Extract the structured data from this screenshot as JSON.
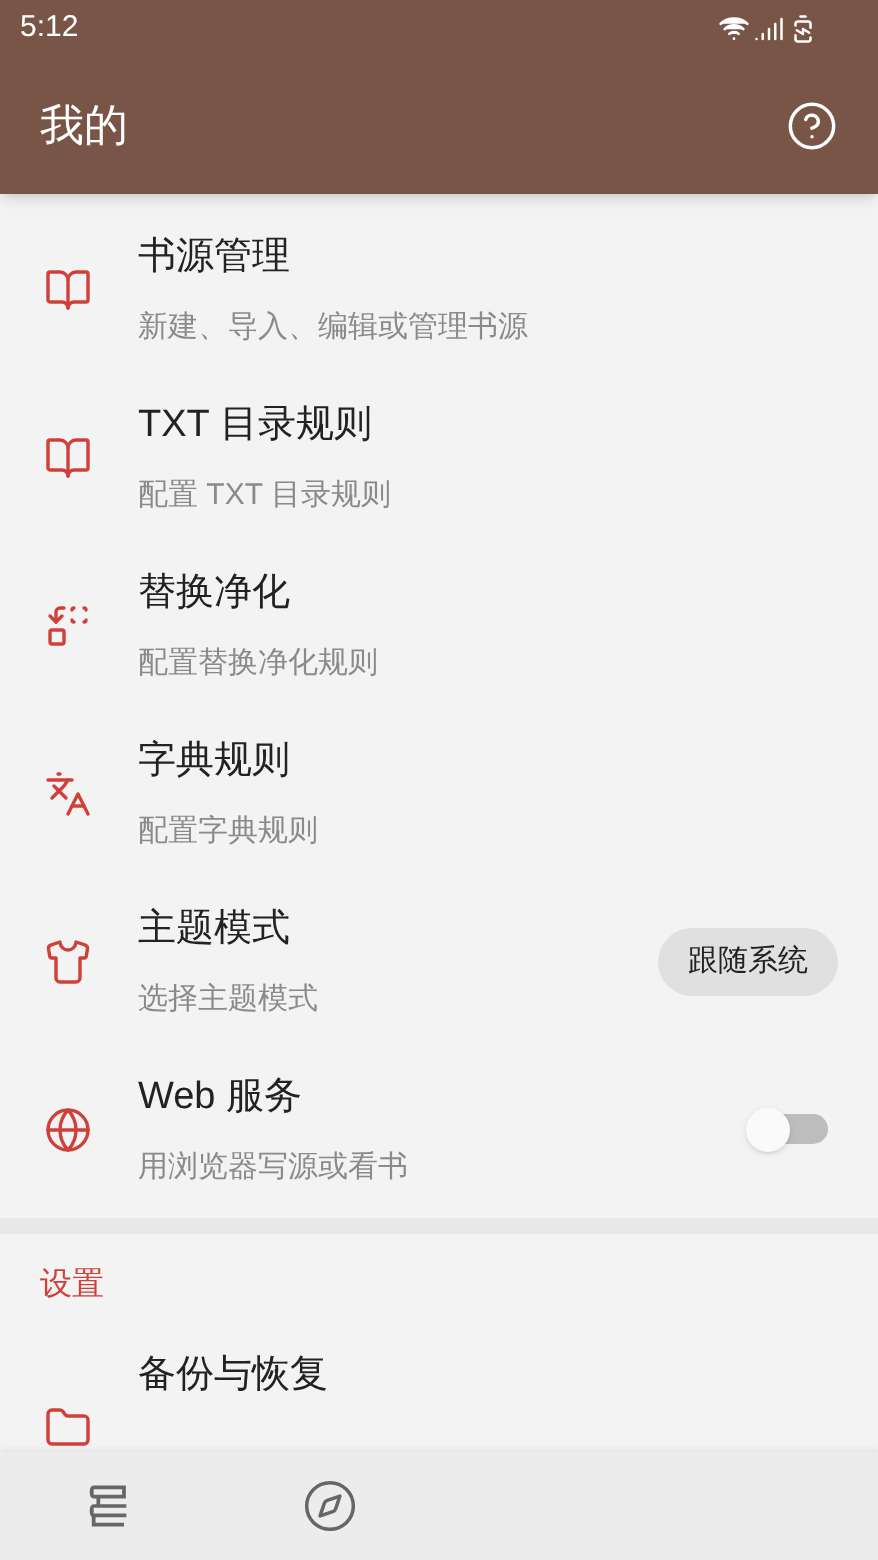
{
  "status_bar": {
    "time": "5:12"
  },
  "toolbar": {
    "title": "我的"
  },
  "items": [
    {
      "kind": "plain",
      "title": "书源管理",
      "subtitle": "新建、导入、编辑或管理书源"
    },
    {
      "kind": "plain",
      "title": "TXT 目录规则",
      "subtitle": "配置 TXT 目录规则"
    },
    {
      "kind": "plain",
      "title": "替换净化",
      "subtitle": "配置替换净化规则"
    },
    {
      "kind": "plain",
      "title": "字典规则",
      "subtitle": "配置字典规则"
    },
    {
      "kind": "chip",
      "title": "主题模式",
      "subtitle": "选择主题模式",
      "value": "跟随系统"
    },
    {
      "kind": "switch",
      "title": "Web 服务",
      "subtitle": "用浏览器写源或看书",
      "on": false
    }
  ],
  "settings": {
    "header": "设置",
    "items": [
      {
        "title": "备份与恢复"
      }
    ]
  },
  "bottom_nav": [
    {
      "selected": false
    },
    {
      "selected": false
    }
  ]
}
